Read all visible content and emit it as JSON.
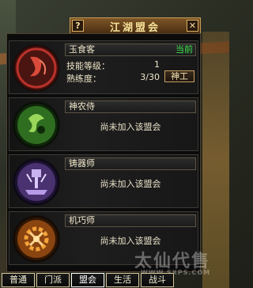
{
  "window": {
    "title": "江湖盟会",
    "help_label": "?",
    "close_label": "✕"
  },
  "professions": [
    {
      "name": "玉食客",
      "current_tag": "当前",
      "skill_level_label": "技能等级：",
      "skill_level_value": "1",
      "proficiency_label": "熟练度：",
      "proficiency_value": "3/30",
      "action_label": "神工",
      "emblem_icon": "red-dragon-emblem-icon",
      "emblem_color": "#b8322a"
    },
    {
      "name": "神农侍",
      "status": "尚未加入该盟会",
      "emblem_icon": "green-swirl-emblem-icon",
      "emblem_color": "#3f8a2a"
    },
    {
      "name": "铸器师",
      "status": "尚未加入该盟会",
      "emblem_icon": "purple-forge-emblem-icon",
      "emblem_color": "#6d4a9c"
    },
    {
      "name": "机巧师",
      "status": "尚未加入该盟会",
      "emblem_icon": "orange-gear-emblem-icon",
      "emblem_color": "#c86a14"
    }
  ],
  "tabs": [
    {
      "label": "普通"
    },
    {
      "label": "门派"
    },
    {
      "label": "盟会",
      "active": true
    },
    {
      "label": "生活"
    },
    {
      "label": "战斗"
    }
  ],
  "watermark": {
    "text": "太仙代售",
    "url": "WWW.SXPS.COM"
  }
}
